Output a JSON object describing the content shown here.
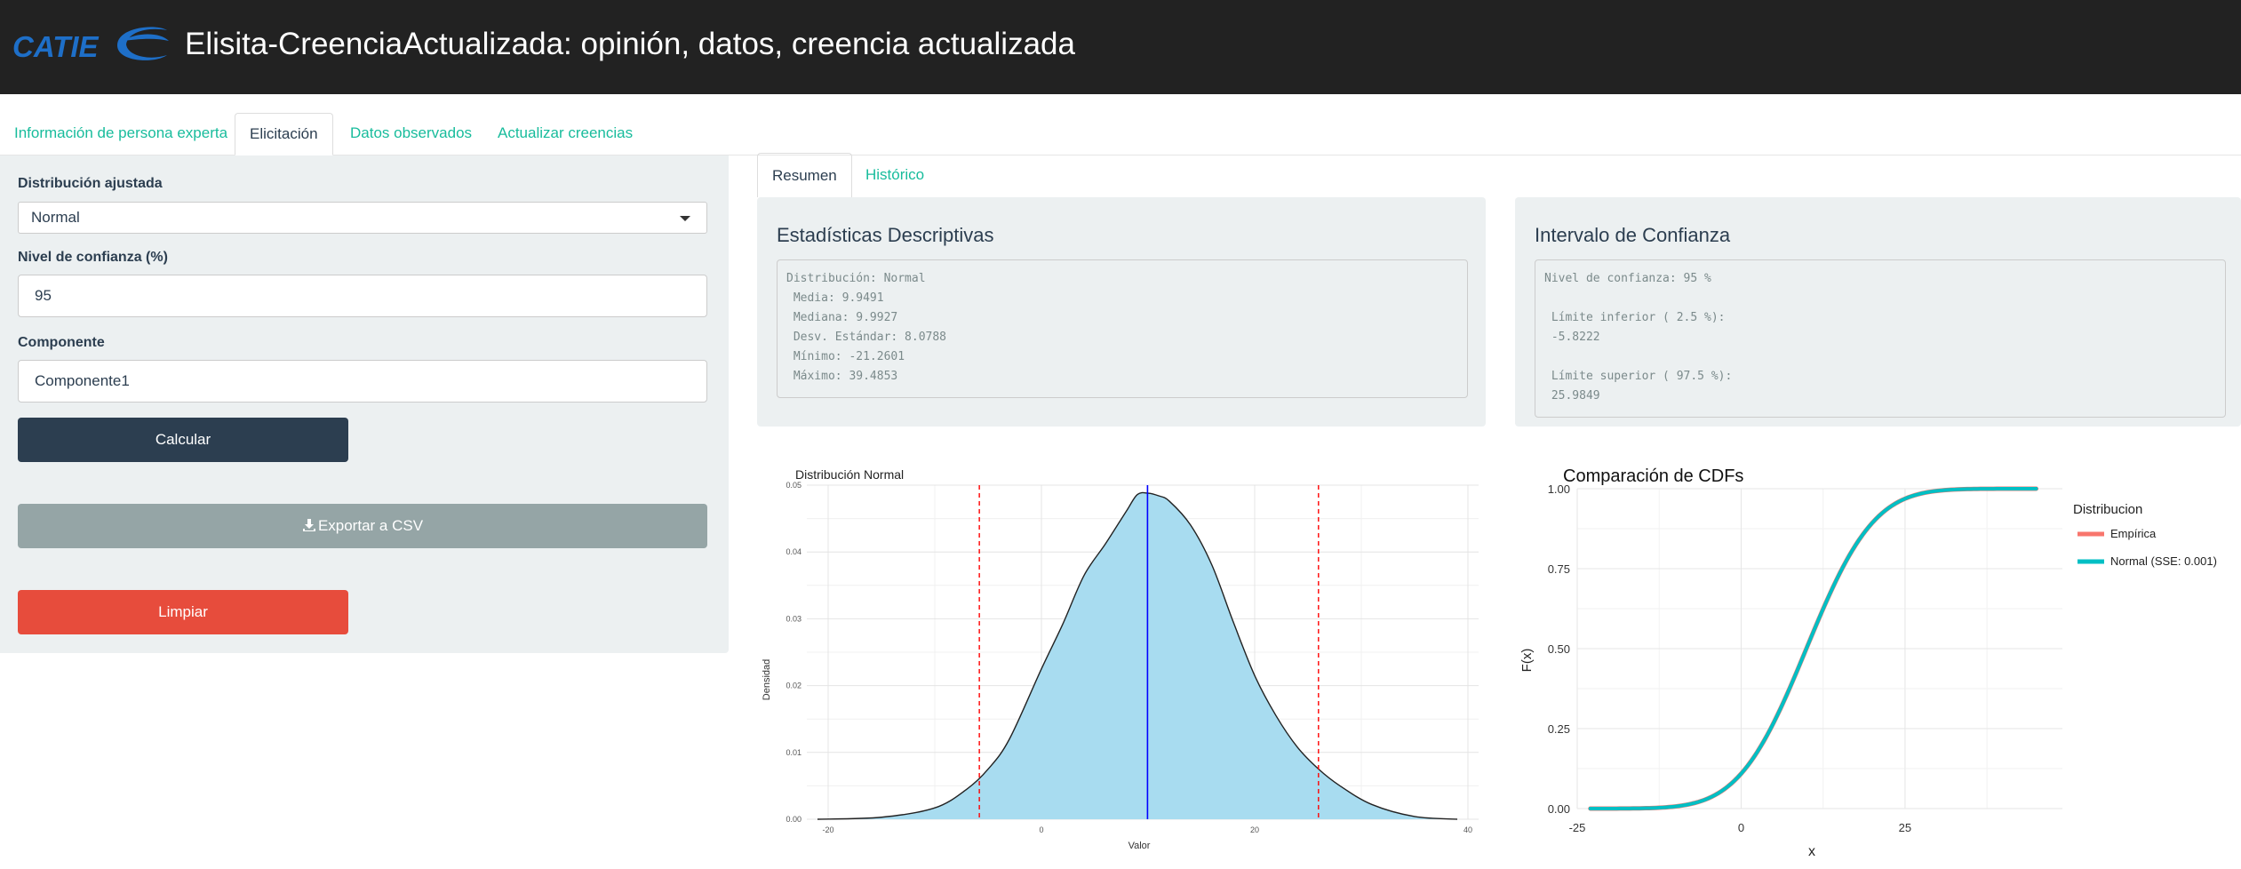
{
  "header": {
    "logo_text": "CATIE",
    "title": "Elisita-CreenciaActualizada: opinión, datos, creencia actualizada"
  },
  "nav_tabs": [
    {
      "label": "Información de persona experta"
    },
    {
      "label": "Elicitación"
    },
    {
      "label": "Datos observados"
    },
    {
      "label": "Actualizar creencias"
    }
  ],
  "active_nav_tab": "Elicitación",
  "sidebar": {
    "dist_label": "Distribución ajustada",
    "dist_value": "Normal",
    "conf_label": "Nivel de confianza (%)",
    "conf_value": "95",
    "comp_label": "Componente",
    "comp_value": "Componente1",
    "calc_button": "Calcular",
    "export_button": "Exportar a CSV",
    "clear_button": "Limpiar"
  },
  "sub_tabs": [
    {
      "label": "Resumen"
    },
    {
      "label": "Histórico"
    }
  ],
  "active_sub_tab": "Resumen",
  "stats_panel": {
    "title": "Estadísticas Descriptivas",
    "output": "Distribución: Normal\n Media: 9.9491\n Mediana: 9.9927\n Desv. Estándar: 8.0788\n Mínimo: -21.2601\n Máximo: 39.4853"
  },
  "ci_panel": {
    "title": "Intervalo de Confianza",
    "output": "Nivel de confianza: 95 %\n\n Límite inferior ( 2.5 %):\n -5.8222\n\n Límite superior ( 97.5 %):\n 25.9849"
  },
  "chart_data": [
    {
      "type": "area",
      "title": "Distribución Normal",
      "xlabel": "Valor",
      "ylabel": "Densidad",
      "xlim": [
        -22,
        41
      ],
      "ylim": [
        0,
        0.05
      ],
      "x_ticks": [
        -20,
        0,
        20,
        40
      ],
      "y_ticks": [
        "0.00",
        "0.01",
        "0.02",
        "0.03",
        "0.04",
        "0.05"
      ],
      "fill_color": "#a8dcf0",
      "x": [
        -21,
        -15,
        -10,
        -7,
        -5,
        -3,
        0,
        2,
        4,
        6,
        8,
        9,
        10,
        11,
        12,
        14,
        16,
        18,
        20,
        22,
        24,
        26,
        28,
        31,
        35,
        39
      ],
      "y": [
        0.0,
        0.0003,
        0.0017,
        0.0045,
        0.0075,
        0.012,
        0.0225,
        0.0292,
        0.0365,
        0.0412,
        0.0462,
        0.0486,
        0.0488,
        0.0484,
        0.0476,
        0.044,
        0.038,
        0.0295,
        0.0215,
        0.0155,
        0.0108,
        0.0075,
        0.005,
        0.0022,
        0.0004,
        0.0
      ],
      "mean_line": 9.95,
      "ci_lines": [
        -5.8222,
        25.9849
      ],
      "mean_line_color": "#0000ff",
      "ci_line_color": "#ff0000"
    },
    {
      "type": "line",
      "title": "Comparación de CDFs",
      "xlabel": "x",
      "ylabel": "F(x)",
      "xlim": [
        -25,
        49
      ],
      "ylim": [
        0,
        1
      ],
      "x_ticks": [
        -25,
        0,
        25
      ],
      "y_ticks": [
        "0.00",
        "0.25",
        "0.50",
        "0.75",
        "1.00"
      ],
      "legend_title": "Distribucion",
      "legend_position": "right",
      "series": [
        {
          "name": "Empírica",
          "color": "#f8766d",
          "mean": 9.9491,
          "sd": 8.0788
        },
        {
          "name": "Normal (SSE: 0.001)",
          "color": "#00bfc4",
          "mean": 9.9491,
          "sd": 8.0788
        }
      ]
    }
  ]
}
